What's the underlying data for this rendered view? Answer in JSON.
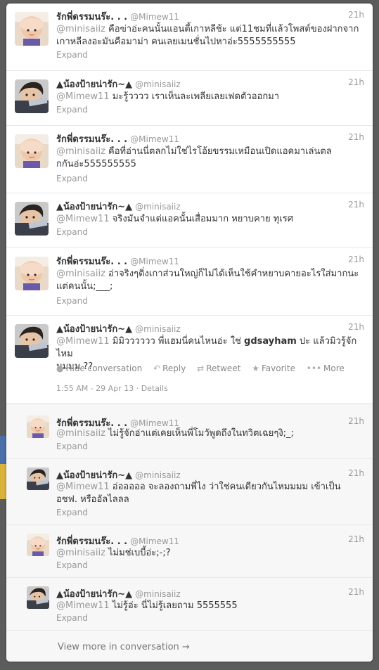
{
  "tweets": [
    {
      "name": "รักพี่ดรรมนร๊ะ. . .",
      "handle": "@Mimew11",
      "time": "21h",
      "mention": "@minisaiiz",
      "line1": " คือฃ่าอ่ะคนนั้นแอนตี้เกาหลีช้ะ แต่11ชมที่แล้วโพสต์ของฝากจาก",
      "line2": "เกาหลีลงอะมันคือมาม่า คนเลยเมนชั่นไปหาอ่ะ5555555555",
      "expand": "Expand"
    },
    {
      "name": "▲น้องป้ายน่ารัก~▲",
      "handle": "@minisaiiz",
      "time": "21h",
      "mention": "@Mimew11",
      "line1": " มะรู้วววว เราเห็นละเพลียเลยเฟดตัวออกมา",
      "line2": "",
      "expand": "Expand"
    },
    {
      "name": "รักพี่ดรรมนร๊ะ. . .",
      "handle": "@Mimew11",
      "time": "21h",
      "mention": "@minisaiiz",
      "line1": " คือที่อ่านนี่ตลกไม่ใช่ไรโอ้ยขรรมเหมือนเปิดแอคมาเล่นตล",
      "line2": "กกันอ่ะ555555555",
      "expand": "Expand"
    },
    {
      "name": "▲น้องป้ายน่ารัก~▲",
      "handle": "@minisaiiz",
      "time": "21h",
      "mention": "@Mimew11",
      "line1": " จริงมันจำแต่แอคนั้นเสื่อมมาก หยาบคาย ทุเรศ",
      "line2": "",
      "expand": "Expand"
    },
    {
      "name": "รักพี่ดรรมนร๊ะ. . .",
      "handle": "@Mimew11",
      "time": "21h",
      "mention": "@minisaiiz",
      "line1": " อ่าจริงๆติ่งเกาส่วนใหญ่ก็ไม่ได้เห็นใช้คำหยาบคายอะไรใส่มากนะ",
      "line2": "แต่คนนั้น;___;",
      "expand": "Expand"
    }
  ],
  "focused": {
    "name": "▲น้องป้ายน่ารัก~▲",
    "handle": "@minisaiiz",
    "time": "21h",
    "mention": "@Mimew11",
    "text_a": " มิมิวววววว พี่แฮมนี่คนไหนอ่ะ ใช่ ",
    "bold": "gdsayham",
    "text_b": " ปะ แล้วมิวรู้จักไหม",
    "line2": "มมมม ??",
    "actions": {
      "hide": "Hide conversation",
      "reply": "Reply",
      "retweet": "Retweet",
      "favorite": "Favorite",
      "more": "More"
    },
    "timestamp": "1:55 AM - 29 Apr 13",
    "details": "Details"
  },
  "replies": [
    {
      "name": "รักพี่ดรรมนร๊ะ. . .",
      "handle": "@Mimew11",
      "time": "21h",
      "mention": "@minisaiiz",
      "line1": " ไม่รู้จักอ่าแต่เคยเห็นพี่โมวัพูดถึงในทวิตเฉยๆงิ;_;",
      "line2": "",
      "expand": "Expand"
    },
    {
      "name": "▲น้องป้ายน่ารัก~▲",
      "handle": "@minisaiiz",
      "time": "21h",
      "mention": "@Mimew11",
      "line1": " อ่อออออ จะลองถามพี่ไง ว่าใช่คนเดียวกันไหมมมม เข้าเป็น",
      "line2": "อชฟ. หรืออัลไลลล",
      "expand": "Expand"
    },
    {
      "name": "รักพี่ดรรมนร๊ะ. . .",
      "handle": "@Mimew11",
      "time": "21h",
      "mention": "@minisaiiz",
      "line1": " ไม่มช่เบบี้อ่ะ;-;?",
      "line2": "",
      "expand": "Expand"
    },
    {
      "name": "▲น้องป้ายน่ารัก~▲",
      "handle": "@minisaiiz",
      "time": "21h",
      "mention": "@Mimew11",
      "line1": " ไม่รู้อ่ะ นี่ไม่รู้เลยถาม 5555555",
      "line2": "",
      "expand": "Expand"
    }
  ],
  "view_more": "View more in conversation →"
}
